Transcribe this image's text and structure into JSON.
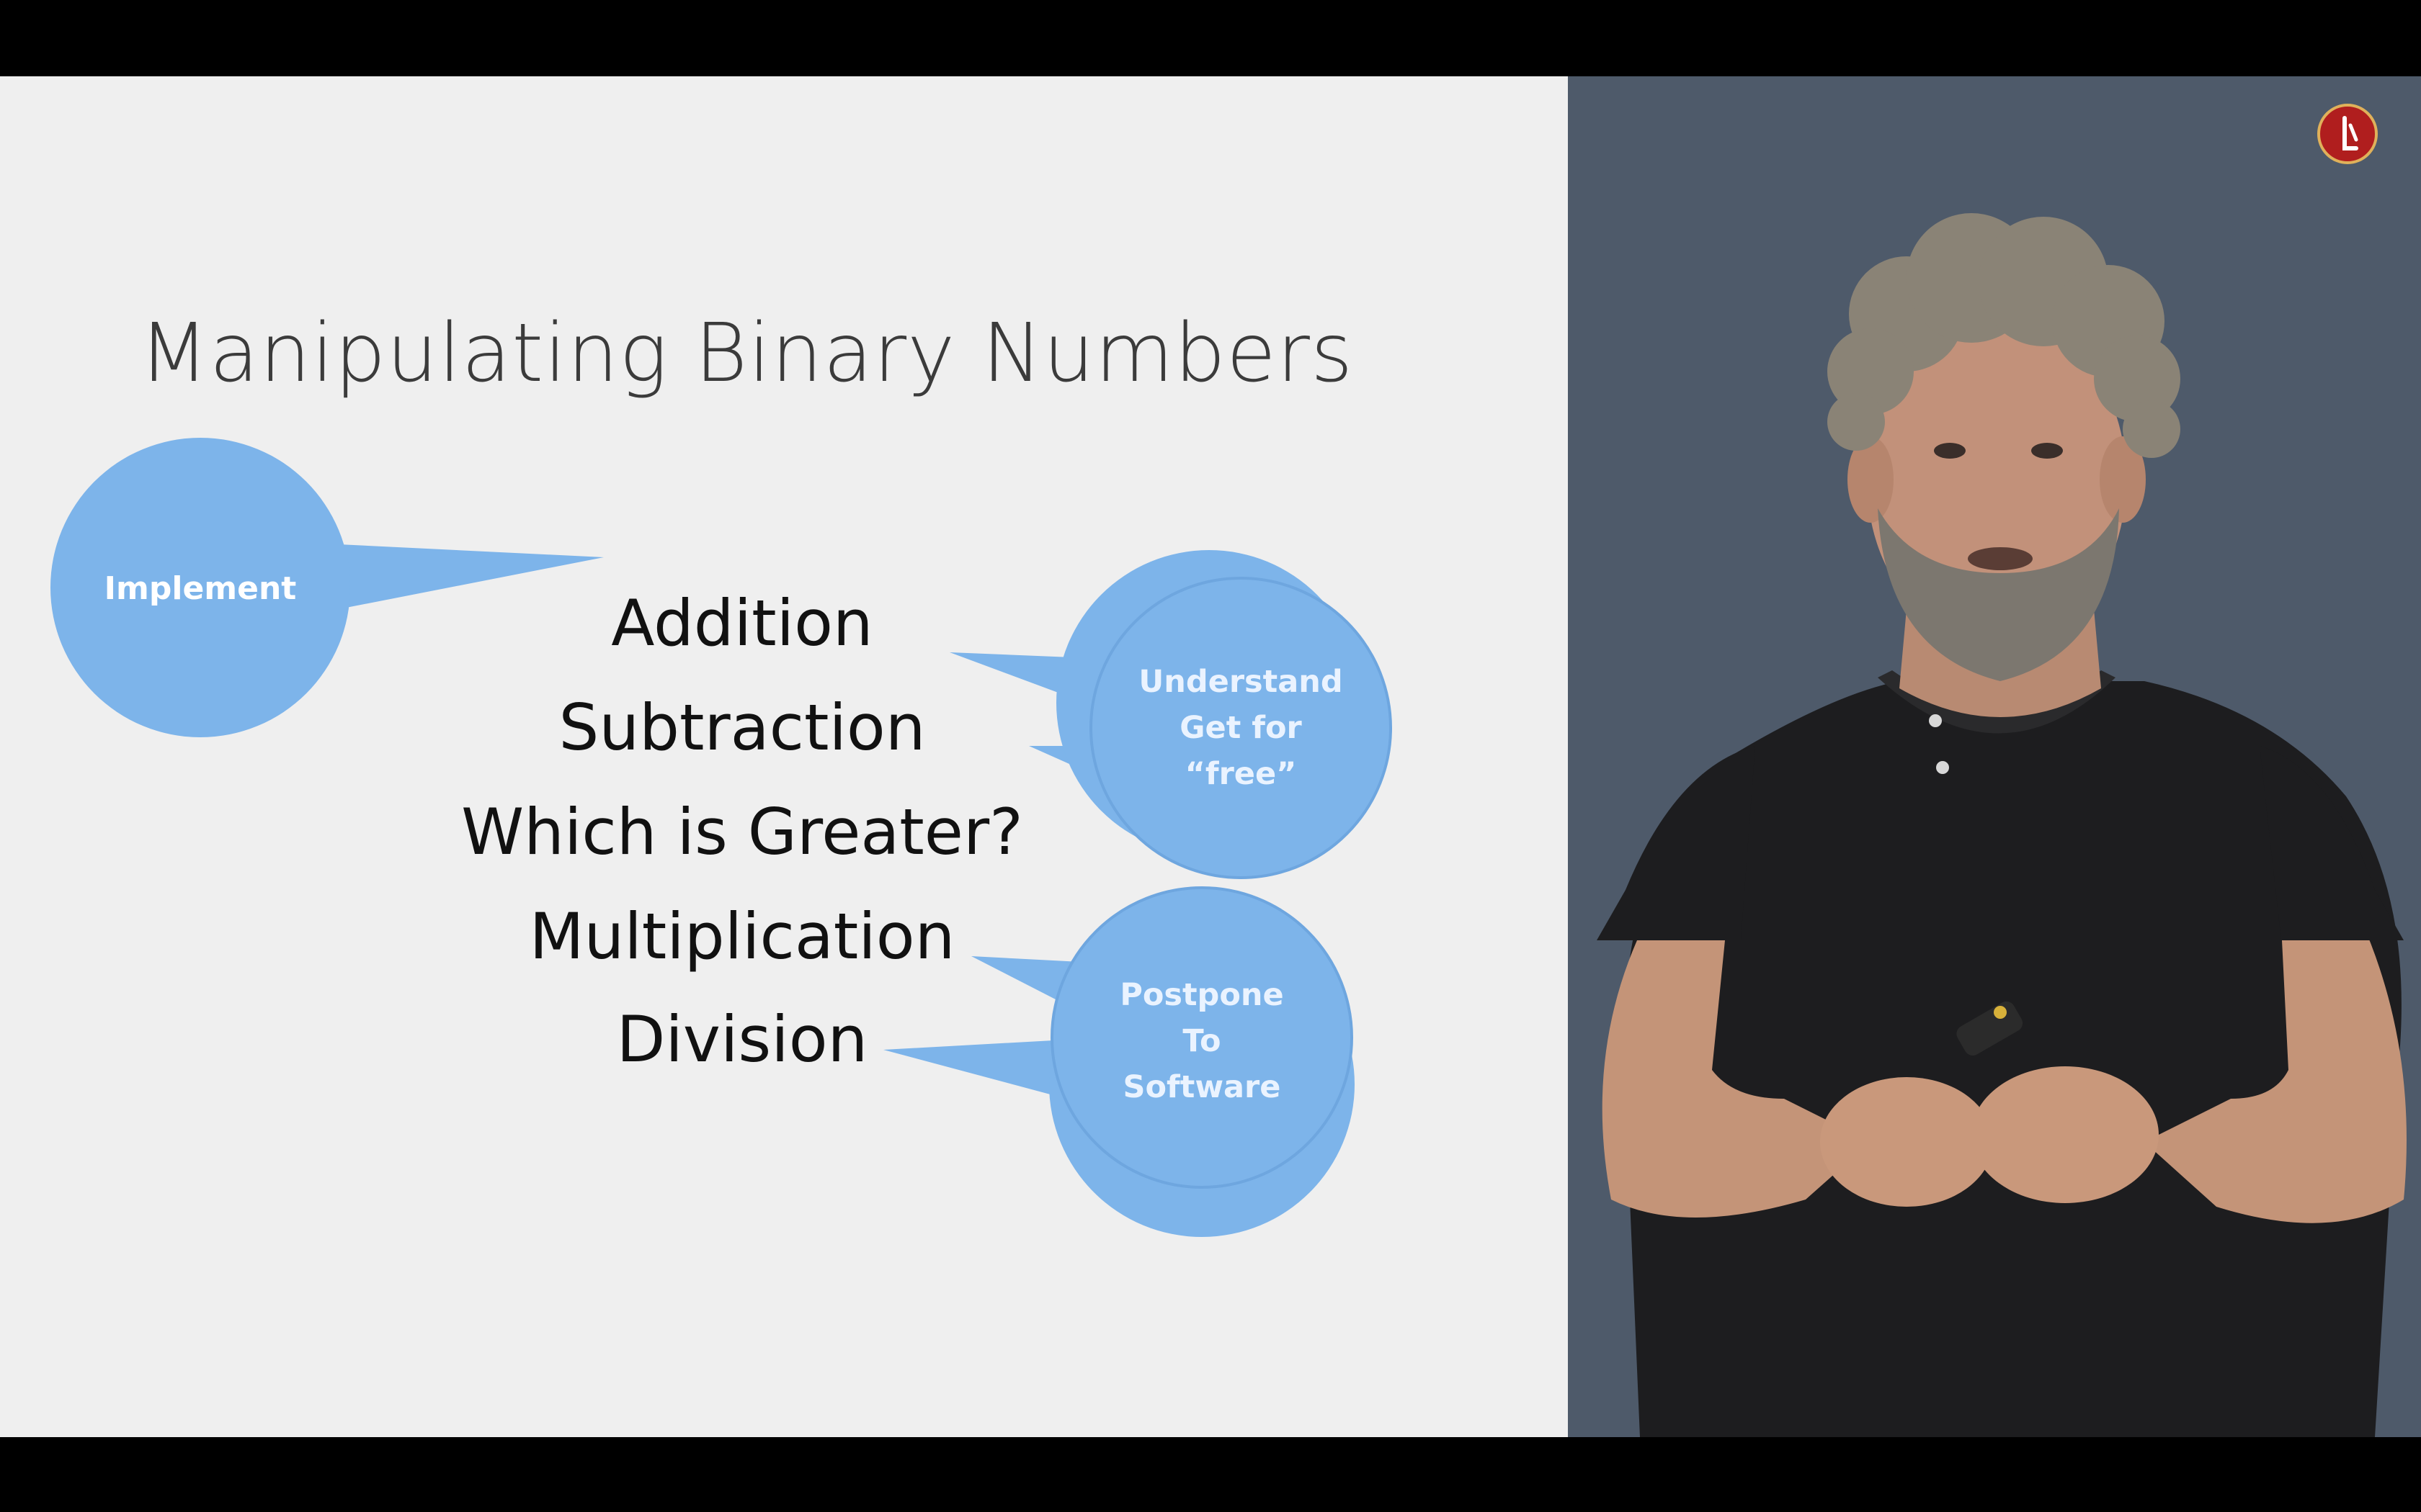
{
  "slide": {
    "title": "Manipulating Binary Numbers",
    "operations": [
      "Addition",
      "Subtraction",
      "Which is Greater?",
      "Multiplication",
      "Division"
    ],
    "bubbles": {
      "implement": {
        "lines": [
          "Implement"
        ]
      },
      "understand": {
        "lines": [
          "Understand",
          "Get for",
          "“free”"
        ]
      },
      "postpone": {
        "lines": [
          "Postpone",
          "To",
          "Software"
        ]
      }
    },
    "colors": {
      "background": "#efefef",
      "bubble": "#7db4ea",
      "bubble_edge": "#5f97d1",
      "title_text": "#3b3b3b",
      "operation_text": "#111111"
    }
  },
  "speaker_panel": {
    "background_color": "#4e5a6a",
    "logo_icon": "channel-logo-icon"
  }
}
